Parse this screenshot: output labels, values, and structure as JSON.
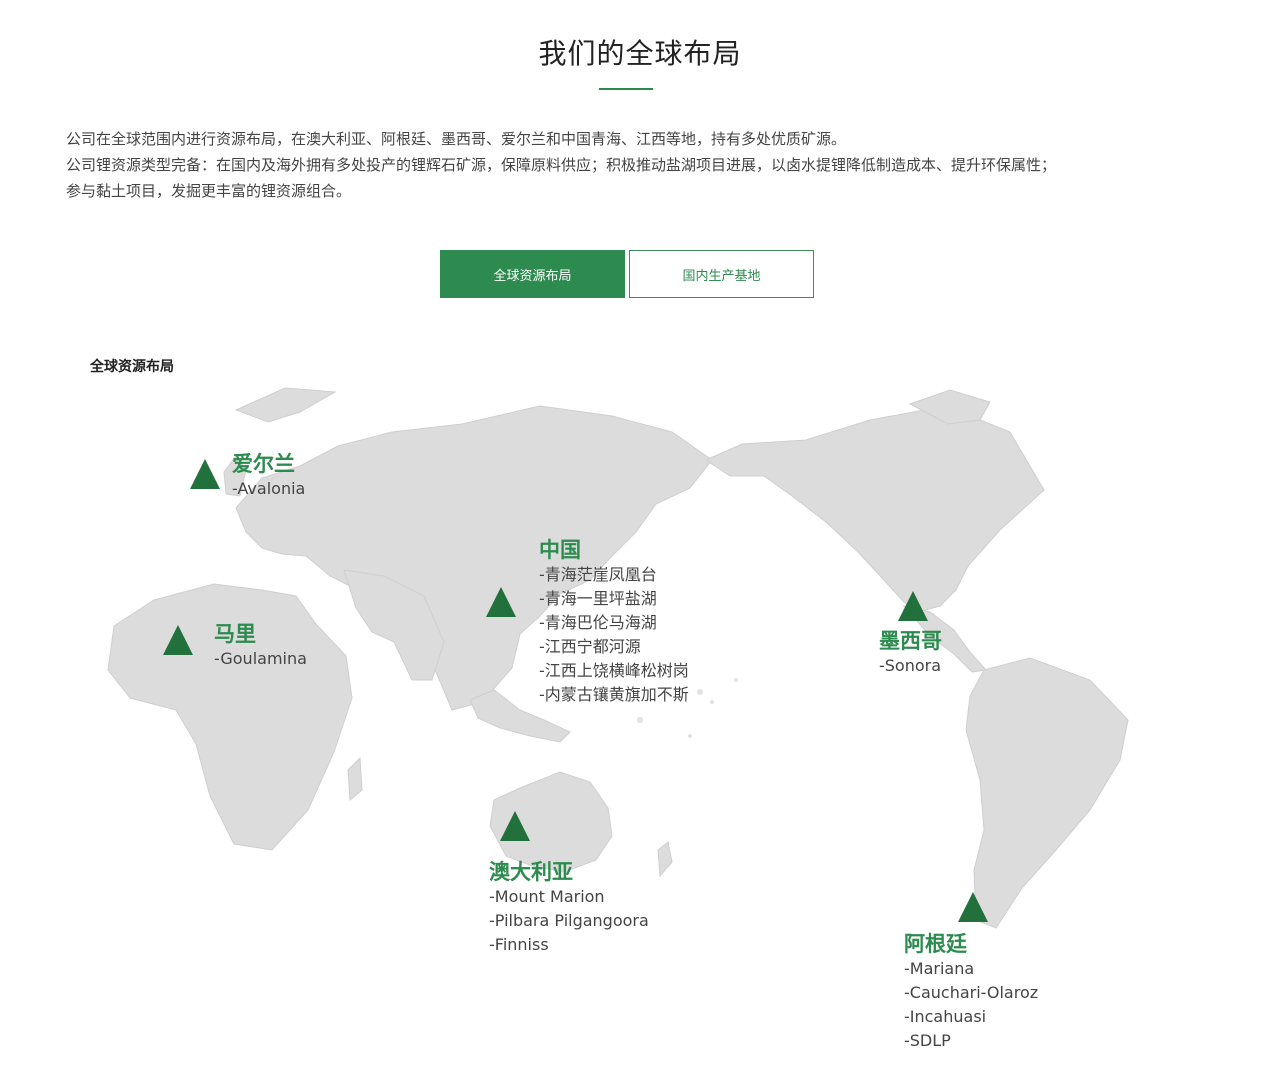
{
  "page": {
    "title": "我们的全球布局",
    "intro": [
      "公司在全球范围内进行资源布局，在澳大利亚、阿根廷、墨西哥、爱尔兰和中国青海、江西等地，持有多处优质矿源。",
      "公司锂资源类型完备：在国内及海外拥有多处投产的锂辉石矿源，保障原料供应；积极推动盐湖项目进展，以卤水提锂降低制造成本、提升环保属性；",
      "参与黏土项目，发掘更丰富的锂资源组合。"
    ]
  },
  "tabs": [
    {
      "label": "全球资源布局",
      "active": true
    },
    {
      "label": "国内生产基地",
      "active": false
    }
  ],
  "section_label": "全球资源布局",
  "map": {
    "land_color": "#dcdcdc",
    "marker_color": "#22703c",
    "name_color": "#2e8b4f",
    "locations": [
      {
        "name": "爱尔兰",
        "items": [
          "-Avalonia"
        ]
      },
      {
        "name": "马里",
        "items": [
          "-Goulamina"
        ]
      },
      {
        "name": "中国",
        "items": [
          "-青海茫崖凤凰台",
          "-青海一里坪盐湖",
          "-青海巴伦马海湖",
          "-江西宁都河源",
          "-江西上饶横峰松树岗",
          "-内蒙古镶黄旗加不斯"
        ]
      },
      {
        "name": "墨西哥",
        "items": [
          "-Sonora"
        ]
      },
      {
        "name": "澳大利亚",
        "items": [
          "-Mount Marion",
          "-Pilbara Pilgangoora",
          "-Finniss"
        ]
      },
      {
        "name": "阿根廷",
        "items": [
          "-Mariana",
          "-Cauchari-Olaroz",
          "-Incahuasi",
          "-SDLP"
        ]
      }
    ]
  }
}
